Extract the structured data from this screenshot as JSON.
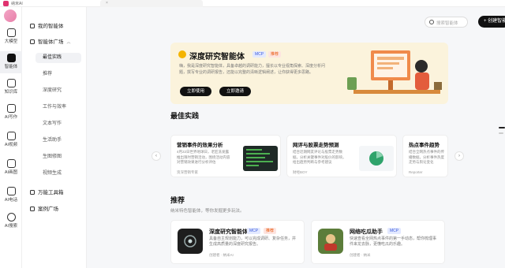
{
  "app": {
    "name": "纳米AI"
  },
  "rail": [
    {
      "label": "大模型"
    },
    {
      "label": "智能体"
    },
    {
      "label": "知识库"
    },
    {
      "label": "AI写作"
    },
    {
      "label": "AI视频"
    },
    {
      "label": "AI画图"
    },
    {
      "label": "AI电话"
    },
    {
      "label": "AI搜索"
    }
  ],
  "nav": {
    "my_agents": "我的智能体",
    "plaza": "智能体广场",
    "plaza_items": [
      "最佳实践",
      "推荐",
      "深度研究",
      "工作与效率",
      "文本写作",
      "生活助手",
      "生图修图",
      "视频生成"
    ],
    "tools": "万能工具箱",
    "cases": "案例广场"
  },
  "header": {
    "search_placeholder": "搜索智能体",
    "create_label": "+ 创建智能体"
  },
  "hero": {
    "title": "深度研究智能体",
    "badge_mcp": "MCP",
    "badge_rec": "推荐",
    "desc": "嗨，我是深度研究智能体，具备卓越的调研能力，擅长以专业视角探索、深度分析问题，撰写专业的调研报告，还能以完整的清晰逻辑阐述，让你获得更多思路。",
    "btn_use": "立即使用",
    "btn_invite": "立即邀请"
  },
  "best": {
    "title": "最佳实践",
    "cards": [
      {
        "title": "营销事件的效果分析",
        "desc": "4月22日世界地球日，老匠洗发露推出限时营销活动，围绕活动内容对营销效果进行分析评估",
        "author": "资深营销专家"
      },
      {
        "title": "网评与股票走势预测",
        "desc": "结合近期网友评论与股票走势数据，分析关键事件对股价的影响，给出趋势判断与参考建议",
        "author": "财经BOY"
      },
      {
        "title": "热点事件趋势",
        "desc": "结合全网热点事件的传播数据，分析事件热度走势与舆论变化",
        "author": "Reporter"
      }
    ]
  },
  "rec": {
    "title": "推荐",
    "subtitle": "纳米特色智能体，等你发掘更多玩法。",
    "cards": [
      {
        "title": "深度研究智能体",
        "badge_mcp": "MCP",
        "badge_rec": "推荐",
        "desc": "具备自主规划能力，可以完成调研、复杂任务，并生成高质量的深度研究报告。",
        "meta": "创建者 · 纳米AI"
      },
      {
        "title": "网络吃瓜助手",
        "badge_mcp": "MCP",
        "desc": "快速查看全网热点事件的第一手动态，帮你梳理事件来龙去脉，更懂吃瓜的乐趣。",
        "meta": "创建者 · 纳米"
      }
    ]
  },
  "colors": {
    "accent": "#111111",
    "hero_bg": "#fbf3dc",
    "badge_mcp": "#3b5bdb",
    "badge_rec": "#e8590c"
  }
}
